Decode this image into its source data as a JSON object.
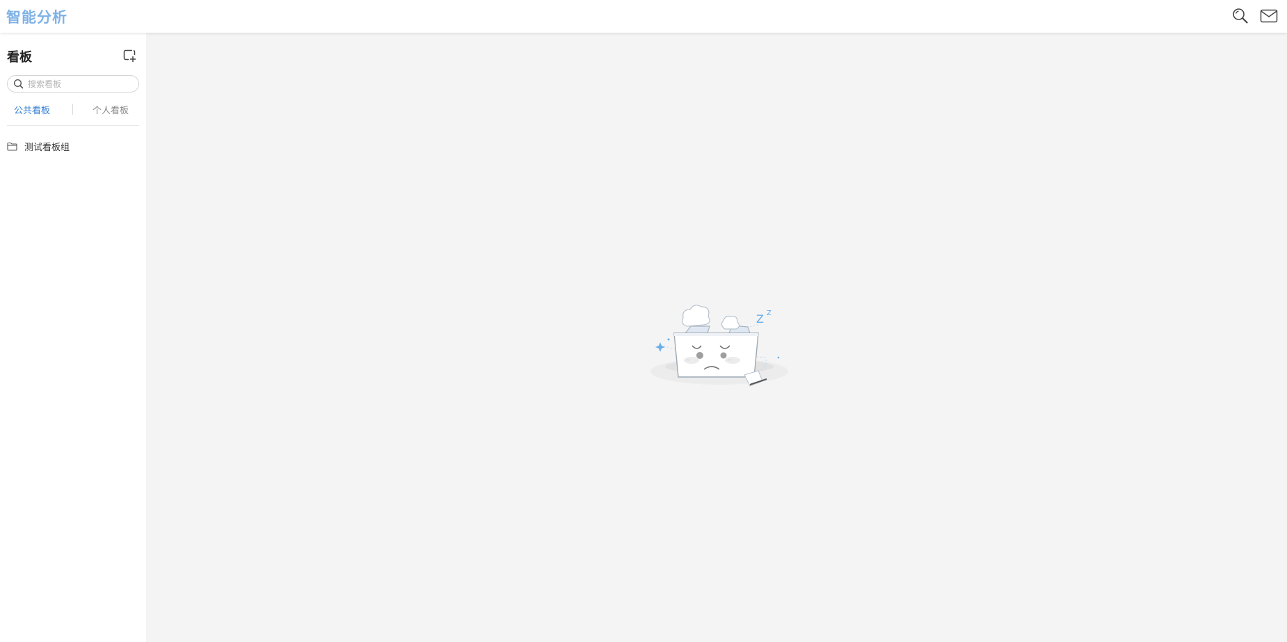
{
  "app": {
    "title": "智能分析"
  },
  "header": {
    "search_icon": "search-icon",
    "mail_icon": "mail-icon"
  },
  "sidebar": {
    "title": "看板",
    "add_icon": "add-board-icon",
    "search": {
      "placeholder": "搜索看板",
      "value": ""
    },
    "tabs": [
      {
        "label": "公共看板",
        "active": true
      },
      {
        "label": "个人看板",
        "active": false
      }
    ],
    "tree": [
      {
        "label": "测试看板组",
        "icon": "folder-icon"
      }
    ]
  },
  "main": {
    "empty_state_icon": "empty-box-sleeping-illustration"
  },
  "colors": {
    "brand": "#7fb2e5",
    "active_tab": "#2f7dd1",
    "background": "#f4f4f4"
  }
}
